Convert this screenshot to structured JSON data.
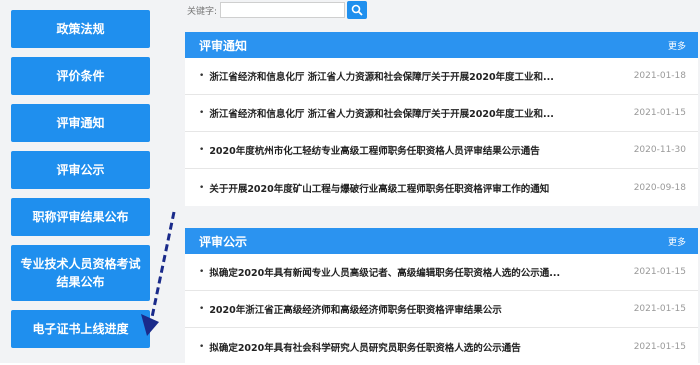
{
  "sidebar": {
    "items": [
      {
        "label": "政策法规"
      },
      {
        "label": "评价条件"
      },
      {
        "label": "评审通知"
      },
      {
        "label": "评审公示"
      },
      {
        "label": "职称评审结果公布"
      },
      {
        "label": "专业技术人员资格考试结果公布"
      },
      {
        "label": "电子证书上线进度"
      }
    ]
  },
  "search": {
    "label": "关键字:",
    "value": "",
    "placeholder": ""
  },
  "notice_panel": {
    "title": "评审通知",
    "more": "更多",
    "rows": [
      {
        "title": "浙江省经济和信息化厅 浙江省人力资源和社会保障厅关于开展2020年度工业和...",
        "date": "2021-01-18"
      },
      {
        "title": "浙江省经济和信息化厅 浙江省人力资源和社会保障厅关于开展2020年度工业和...",
        "date": "2021-01-15"
      },
      {
        "title": "2020年度杭州市化工轻纺专业高级工程师职务任职资格人员评审结果公示通告",
        "date": "2020-11-30"
      },
      {
        "title": "关于开展2020年度矿山工程与爆破行业高级工程师职务任职资格评审工作的通知",
        "date": "2020-09-18"
      }
    ]
  },
  "public_panel": {
    "title": "评审公示",
    "more": "更多",
    "rows": [
      {
        "title": "拟确定2020年具有新闻专业人员高级记者、高级编辑职务任职资格人选的公示通...",
        "date": "2021-01-15"
      },
      {
        "title": "2020年浙江省正高级经济师和高级经济师职务任职资格评审结果公示",
        "date": "2021-01-15"
      },
      {
        "title": "拟确定2020年具有社会科学研究人员研究员职务任职资格人选的公示通告",
        "date": "2021-01-15"
      }
    ]
  },
  "colors": {
    "accent": "#1f8fee",
    "header": "#2b93f0",
    "arrow": "#1a2a8a"
  }
}
